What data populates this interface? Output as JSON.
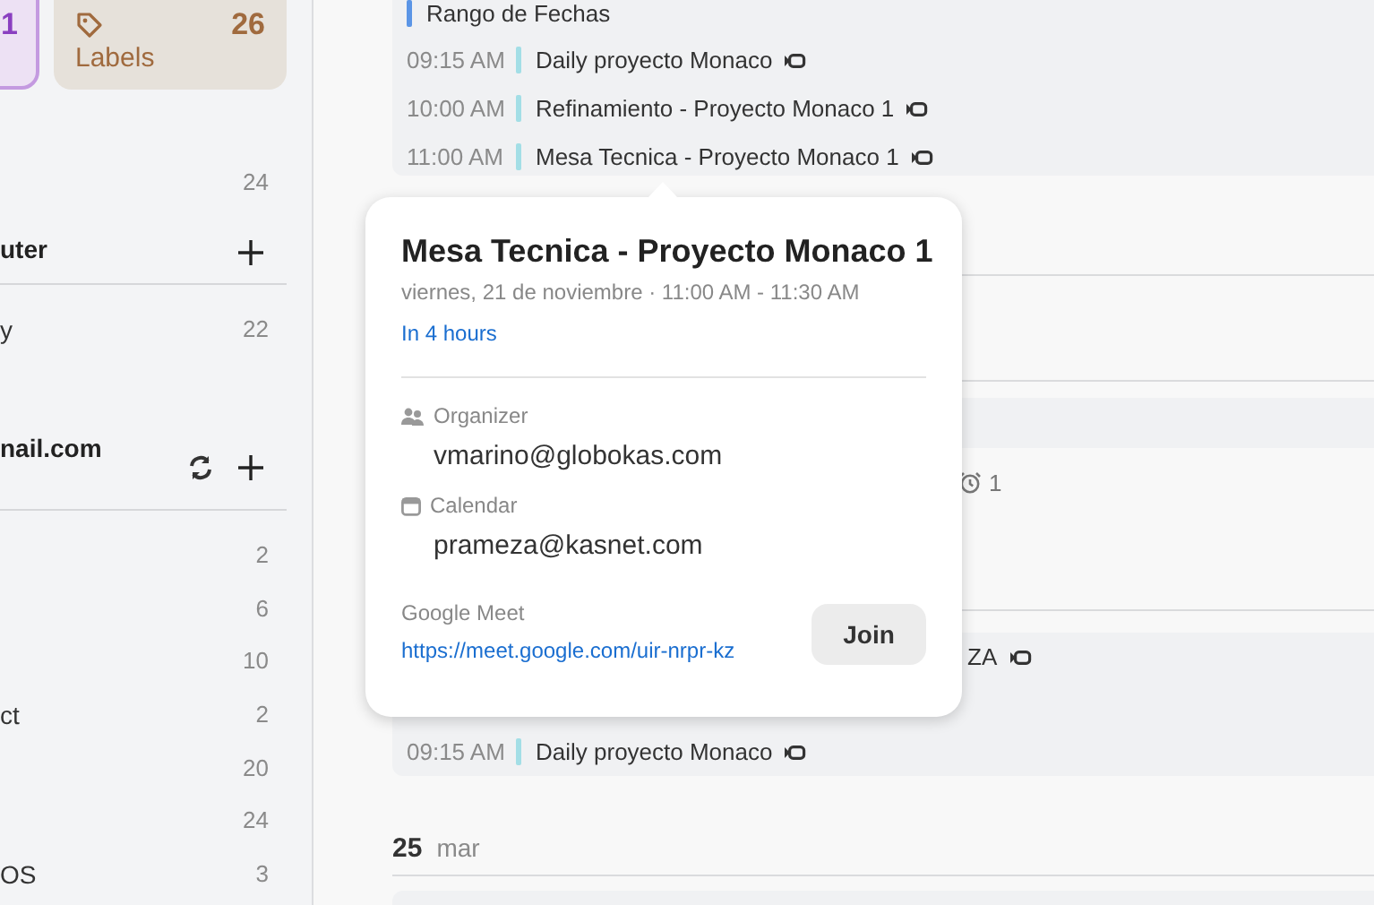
{
  "sidebar": {
    "tiles": [
      {
        "count": "1",
        "selected": true
      },
      {
        "label": "Labels",
        "count": "26",
        "selected": false
      }
    ],
    "rows": [
      {
        "kind": "item",
        "count": "24"
      },
      {
        "kind": "header",
        "label": "uter",
        "sync": false
      },
      {
        "kind": "item",
        "label": "y",
        "count": "22"
      },
      {
        "kind": "header",
        "label": "nail.com",
        "sync": true
      },
      {
        "kind": "item",
        "count": "2"
      },
      {
        "kind": "item",
        "count": "6"
      },
      {
        "kind": "item",
        "count": "10"
      },
      {
        "kind": "item",
        "label": "ct",
        "count": "2"
      },
      {
        "kind": "item",
        "count": "20"
      },
      {
        "kind": "item",
        "count": "24"
      },
      {
        "kind": "item",
        "label": "OS",
        "count": "3"
      }
    ]
  },
  "agenda": {
    "cards": [
      {
        "events": [
          {
            "kind": "event",
            "title": "Rango de Fechas",
            "color": "#5b95e6",
            "video": false
          },
          {
            "kind": "event",
            "time": "09:15 AM",
            "title": "Daily proyecto Monaco",
            "color": "#a3dee6",
            "video": true
          },
          {
            "kind": "event",
            "time": "10:00 AM",
            "title": "Refinamiento - Proyecto Monaco 1",
            "color": "#a3dee6",
            "video": true
          },
          {
            "kind": "event",
            "time": "11:00 AM",
            "title": "Mesa Tecnica - Proyecto Monaco 1",
            "color": "#a3dee6",
            "video": true
          }
        ]
      },
      {
        "events": [
          {
            "kind": "reminder",
            "count": "1"
          }
        ]
      },
      {
        "events": [
          {
            "kind": "partial",
            "title": "ZA",
            "video": true
          },
          {
            "kind": "event",
            "time": "09:15 AM",
            "title": "Daily proyecto Monaco",
            "color": "#a3dee6",
            "video": true
          }
        ]
      }
    ],
    "day": {
      "number": "25",
      "weekday": "mar"
    }
  },
  "popover": {
    "title": "Mesa Tecnica - Proyecto Monaco 1",
    "when": "viernes, 21 de noviembre · 11:00 AM - 11:30 AM",
    "relative": "In 4 hours",
    "organizer_label": "Organizer",
    "organizer": "vmarino@globokas.com",
    "calendar_label": "Calendar",
    "calendar": "prameza@kasnet.com",
    "meet_label": "Google Meet",
    "meet_link": "https://meet.google.com/uir-nrpr-kz",
    "join": "Join"
  }
}
